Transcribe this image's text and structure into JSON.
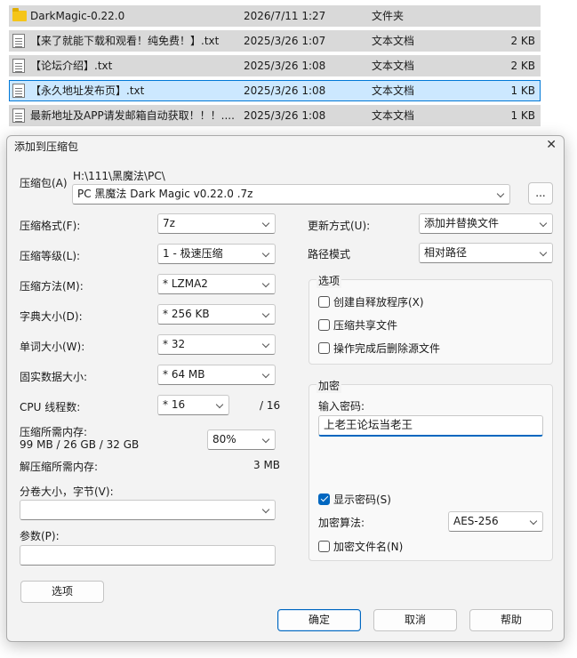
{
  "files": [
    {
      "name": "DarkMagic-0.22.0",
      "date": "2026/7/11 1:27",
      "type": "文件夹",
      "size": "",
      "kind": "folder"
    },
    {
      "name": "【来了就能下载和观看！纯免费！】.txt",
      "date": "2025/3/26 1:07",
      "type": "文本文档",
      "size": "2 KB",
      "kind": "doc"
    },
    {
      "name": "【论坛介绍】.txt",
      "date": "2025/3/26 1:08",
      "type": "文本文档",
      "size": "2 KB",
      "kind": "doc"
    },
    {
      "name": "【永久地址发布页】.txt",
      "date": "2025/3/26 1:08",
      "type": "文本文档",
      "size": "1 KB",
      "kind": "doc"
    },
    {
      "name": "最新地址及APP请发邮箱自动获取！！！....",
      "date": "2025/3/26 1:08",
      "type": "文本文档",
      "size": "1 KB",
      "kind": "doc"
    }
  ],
  "dialog": {
    "title": "添加到压缩包",
    "close_glyph": "✕",
    "archive_label": "压缩包(A)",
    "archive_path": "H:\\111\\黑魔法\\PC\\",
    "archive_name": "PC 黑魔法 Dark Magic v0.22.0 .7z",
    "browse_label": "...",
    "format_label": "压缩格式(F):",
    "format_value": "7z",
    "level_label": "压缩等级(L):",
    "level_value": "1 - 极速压缩",
    "method_label": "压缩方法(M):",
    "method_value": "*  LZMA2",
    "dict_label": "字典大小(D):",
    "dict_value": "*  256 KB",
    "word_label": "单词大小(W):",
    "word_value": "*  32",
    "solid_label": "固实数据大小:",
    "solid_value": "*  64 MB",
    "threads_label": "CPU 线程数:",
    "threads_value": "*  16",
    "threads_max": "/ 16",
    "mem_label": "压缩所需内存:",
    "mem_value": "99 MB / 26 GB / 32 GB",
    "mem_percent": "80%",
    "decomp_label": "解压缩所需内存:",
    "decomp_value": "3 MB",
    "split_label": "分卷大小，字节(V):",
    "split_value": "",
    "params_label": "参数(P):",
    "params_value": "",
    "options_button": "选项",
    "update_label": "更新方式(U):",
    "update_value": "添加并替换文件",
    "pathmode_label": "路径模式",
    "pathmode_value": "相对路径",
    "options_group": "选项",
    "opt_sfx": "创建自释放程序(X)",
    "opt_shared": "压缩共享文件",
    "opt_delete": "操作完成后删除源文件",
    "encryption_group": "加密",
    "password_label": "输入密码:",
    "password_value": "上老王论坛当老王",
    "show_password": "显示密码(S)",
    "enc_method_label": "加密算法:",
    "enc_method_value": "AES-256",
    "encrypt_names": "加密文件名(N)",
    "ok_button": "确定",
    "cancel_button": "取消",
    "help_button": "帮助"
  },
  "colors": {
    "accent": "#0067c0",
    "selection": "#cce8ff",
    "row_bg": "#d9d9d9",
    "folder": "#f5c518"
  }
}
